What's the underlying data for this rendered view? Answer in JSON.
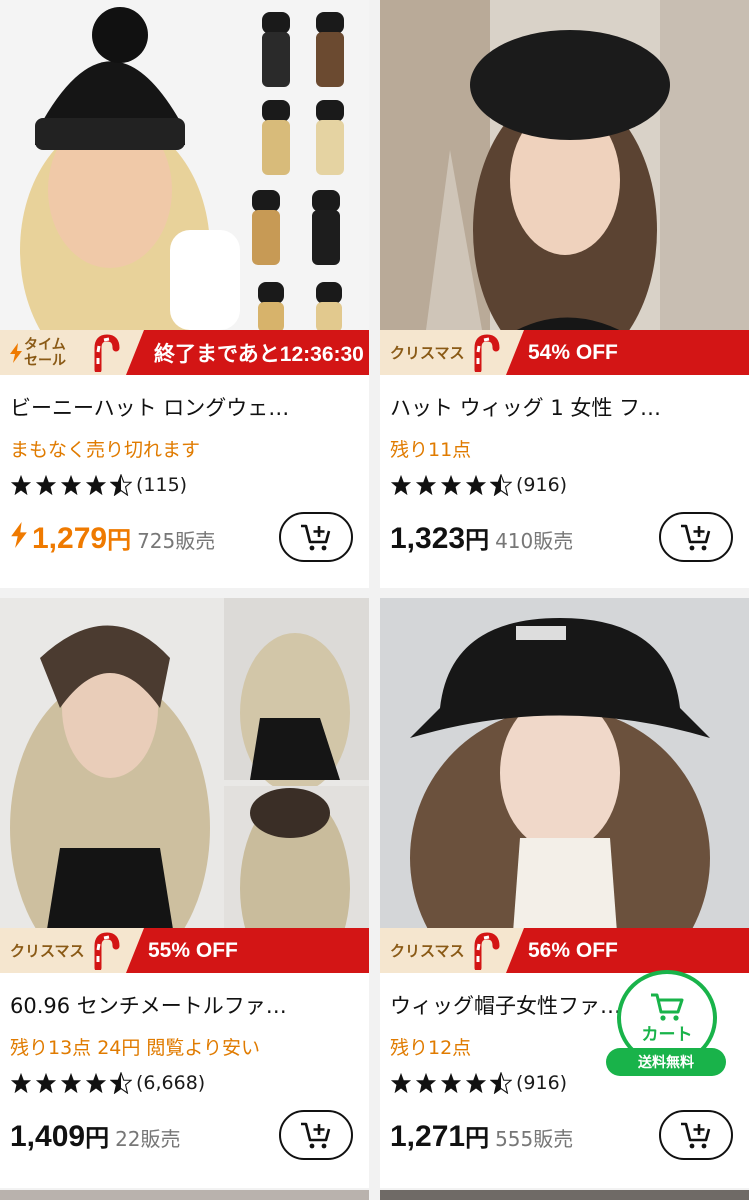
{
  "products": [
    {
      "banner_tag": "タイムセール",
      "banner_tag_line1": "タイム",
      "banner_tag_line2": "セール",
      "banner_text": "終了まであと12:36:30",
      "title": "ビーニーハット ロングウェ…",
      "subtitle": "まもなく売り切れます",
      "rating": 4.5,
      "review_count": "(115)",
      "price": "1,279",
      "currency": "円",
      "sold": "725販売",
      "flash_price": true
    },
    {
      "banner_tag": "クリスマス",
      "banner_text": "54% OFF",
      "title": "ハット ウィッグ 1 女性 フ…",
      "subtitle": "残り11点",
      "rating": 4.5,
      "review_count": "(916)",
      "price": "1,323",
      "currency": "円",
      "sold": "410販売",
      "flash_price": false
    },
    {
      "banner_tag": "クリスマス",
      "banner_text": "55% OFF",
      "title": "60.96 センチメートルファ…",
      "subtitle": "残り13点  24円 閲覧より安い",
      "rating": 4.5,
      "review_count": "(6,668)",
      "price": "1,409",
      "currency": "円",
      "sold": "22販売",
      "flash_price": false
    },
    {
      "banner_tag": "クリスマス",
      "banner_text": "56% OFF",
      "title": "ウィッグ帽子女性ファ…",
      "subtitle": "残り12点",
      "rating": 4.5,
      "review_count": "(916)",
      "price": "1,271",
      "currency": "円",
      "sold": "555販売",
      "flash_price": false
    }
  ],
  "floating_cart": {
    "label": "カート",
    "ribbon": "送料無料",
    "icon": "cart-icon"
  },
  "colors": {
    "sale_red": "#d31515",
    "flash_orange": "#ef7a00",
    "subtitle_orange": "#e07b00",
    "cart_green": "#19b34a",
    "tag_cream": "#f5e6cf"
  },
  "icons": [
    "add-to-cart-icon",
    "star-icon",
    "half-star-icon",
    "lightning-icon",
    "candy-cane-icon",
    "cart-icon"
  ]
}
